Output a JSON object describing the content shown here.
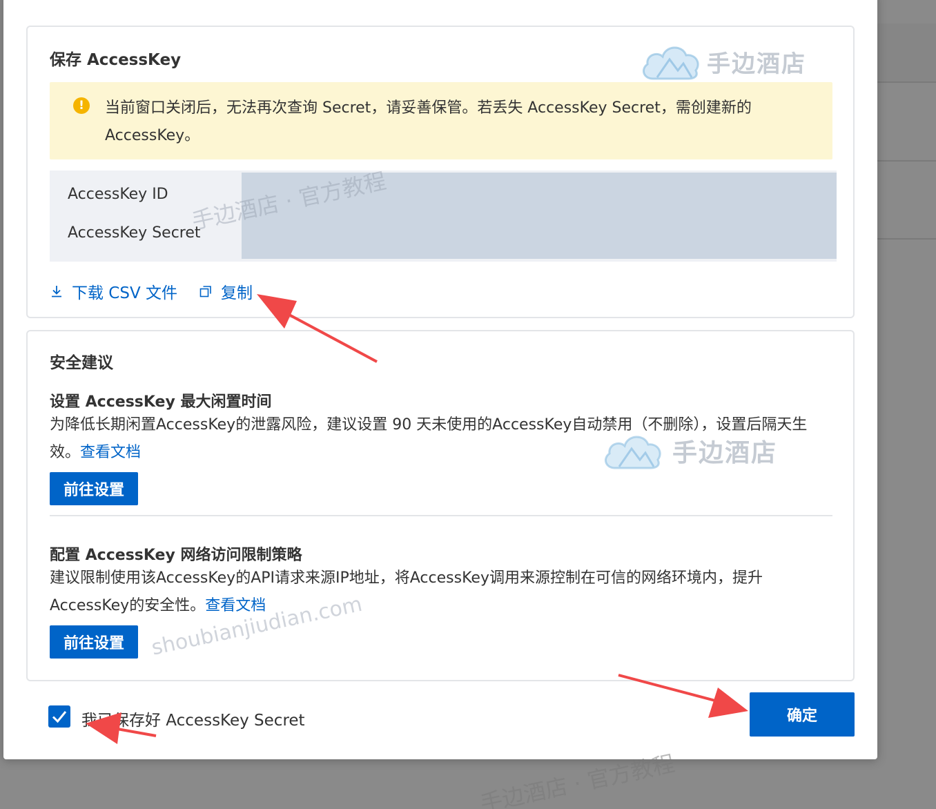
{
  "save_card": {
    "title": "保存 AccessKey",
    "alert_text": "当前窗口关闭后，无法再次查询 Secret，请妥善保管。若丢失 AccessKey Secret，需创建新的AccessKey。",
    "access_key_id_label": "AccessKey ID",
    "access_key_secret_label": "AccessKey Secret",
    "download_link": "下载 CSV 文件",
    "copy_link": "复制"
  },
  "security_card": {
    "title": "安全建议",
    "idle": {
      "heading": "设置 AccessKey 最大闲置时间",
      "description": "为降低长期闲置AccessKey的泄露风险，建议设置 90 天未使用的AccessKey自动禁用（不删除），设置后隔天生效。",
      "doc_link": "查看文档",
      "button": "前往设置"
    },
    "network": {
      "heading": "配置 AccessKey 网络访问限制策略",
      "description": "建议限制使用该AccessKey的API请求来源IP地址，将AccessKey调用来源控制在可信的网络环境内，提升AccessKey的安全性。",
      "doc_link": "查看文档",
      "button": "前往设置"
    }
  },
  "footer": {
    "checkbox_label": "我已保存好 AccessKey Secret",
    "checkbox_checked": true,
    "confirm_button": "确定"
  },
  "watermarks": {
    "brand": "手边酒店",
    "tagline": "手边酒店 · 官方教程",
    "domain": "shoubianjiudian.com"
  },
  "colors": {
    "primary": "#0064c8",
    "alert_bg": "#fdf6d3",
    "alert_icon": "#f5b400",
    "annotation_arrow": "#f04848"
  }
}
